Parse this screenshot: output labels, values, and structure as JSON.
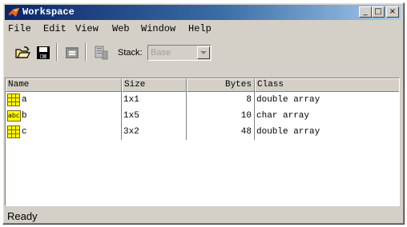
{
  "window": {
    "title": "Workspace"
  },
  "title_buttons": {
    "minimize": "_",
    "maximize": "□",
    "close": "×"
  },
  "menu": [
    "File",
    "Edit",
    "View",
    "Web",
    "Window",
    "Help"
  ],
  "toolbar": {
    "icons": [
      "open-folder-icon",
      "save-icon",
      "import-data-icon",
      "delete-variable-icon"
    ],
    "stack_label": "Stack:",
    "stack_value": "Base"
  },
  "table": {
    "columns": [
      "Name",
      "Size",
      "Bytes",
      "Class"
    ],
    "rows": [
      {
        "icon": "matrix-icon",
        "name": "a",
        "size": "1x1",
        "bytes": "8",
        "class": "double array"
      },
      {
        "icon": "char-icon",
        "icon_text": "abc",
        "name": "b",
        "size": "1x5",
        "bytes": "10",
        "class": "char array"
      },
      {
        "icon": "matrix-icon",
        "name": "c",
        "size": "3x2",
        "bytes": "48",
        "class": "double array"
      }
    ]
  },
  "status": {
    "text": "Ready"
  },
  "colors": {
    "title_start": "#0a246a",
    "title_end": "#a6caf0",
    "face": "#d4d0c8",
    "matrix_icon_fill": "#ffff00",
    "matrix_icon_grid": "#806000"
  }
}
